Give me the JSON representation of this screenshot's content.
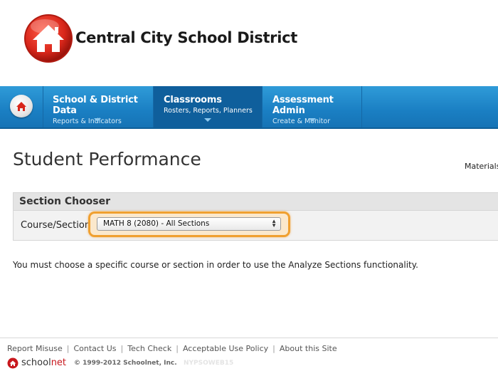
{
  "header": {
    "district_name": "Central City School District",
    "logo_icon": "house-icon",
    "logo_color": "#d8261a"
  },
  "nav": {
    "home_icon": "home-icon",
    "items": [
      {
        "title": "School & District Data",
        "subtitle": "Reports & Indicators",
        "active": false
      },
      {
        "title": "Classrooms",
        "subtitle": "Rosters, Reports, Planners",
        "active": true
      },
      {
        "title": "Assessment Admin",
        "subtitle": "Create & Monitor",
        "active": false
      }
    ],
    "colors": {
      "bar": "#1a7fc3",
      "active": "#0f5f9c"
    }
  },
  "main": {
    "page_title": "Student Performance",
    "materials_link": "Materials",
    "section_chooser": {
      "heading": "Section Chooser",
      "label": "Course/Section",
      "selected_value": "MATH 8 (2080) - All Sections",
      "highlight_color": "#f0a030"
    },
    "notice": "You must choose a specific course or section in order to use the Analyze Sections functionality."
  },
  "footer": {
    "links": [
      "Report Misuse",
      "Contact Us",
      "Tech Check",
      "Acceptable Use Policy",
      "About this Site"
    ],
    "brand_prefix": "school",
    "brand_suffix": "net",
    "copyright": "© 1999-2012 Schoolnet, Inc.",
    "build_id": "NYPSOWEB15"
  }
}
